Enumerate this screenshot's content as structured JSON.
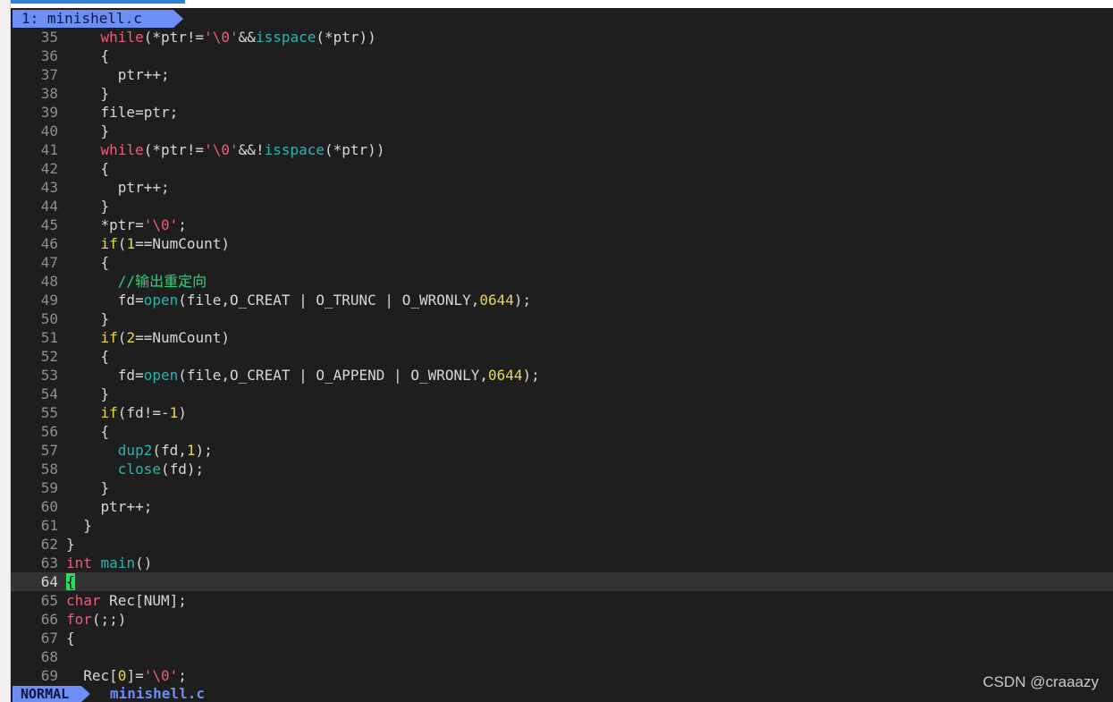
{
  "tabline": {
    "active_tab": "1: minishell.c"
  },
  "statusline": {
    "mode": "NORMAL",
    "filename": "minishell.c"
  },
  "watermark": "CSDN @craaazy",
  "colors": {
    "background": "#1e1e1e",
    "accent": "#6c8ef5",
    "keyword": "#ef5b7b",
    "function": "#28b4b0",
    "number": "#e9d94a",
    "comment": "#34d17a",
    "cursor": "#22e05a"
  },
  "editor": {
    "cursor_line": 64,
    "lines": [
      {
        "n": "35",
        "indent": "    ",
        "tokens": [
          {
            "t": "while",
            "c": "kw"
          },
          {
            "t": "(*ptr!="
          },
          {
            "t": "'\\0'",
            "c": "str"
          },
          {
            "t": "&&"
          },
          {
            "t": "isspace",
            "c": "fn"
          },
          {
            "t": "(*ptr))"
          }
        ]
      },
      {
        "n": "36",
        "indent": "    ",
        "tokens": [
          {
            "t": "{"
          }
        ]
      },
      {
        "n": "37",
        "indent": "      ",
        "tokens": [
          {
            "t": "ptr++;"
          }
        ]
      },
      {
        "n": "38",
        "indent": "    ",
        "tokens": [
          {
            "t": "}"
          }
        ]
      },
      {
        "n": "39",
        "indent": "    ",
        "tokens": [
          {
            "t": "file=ptr;"
          }
        ]
      },
      {
        "n": "40",
        "indent": "    ",
        "tokens": [
          {
            "t": "}"
          }
        ]
      },
      {
        "n": "41",
        "indent": "    ",
        "tokens": [
          {
            "t": "while",
            "c": "kw"
          },
          {
            "t": "(*ptr!="
          },
          {
            "t": "'\\0'",
            "c": "str"
          },
          {
            "t": "&&!"
          },
          {
            "t": "isspace",
            "c": "fn"
          },
          {
            "t": "(*ptr))"
          }
        ]
      },
      {
        "n": "42",
        "indent": "    ",
        "tokens": [
          {
            "t": "{"
          }
        ]
      },
      {
        "n": "43",
        "indent": "      ",
        "tokens": [
          {
            "t": "ptr++;"
          }
        ]
      },
      {
        "n": "44",
        "indent": "    ",
        "tokens": [
          {
            "t": "}"
          }
        ]
      },
      {
        "n": "45",
        "indent": "    ",
        "tokens": [
          {
            "t": "*ptr="
          },
          {
            "t": "'\\0'",
            "c": "str"
          },
          {
            "t": ";"
          }
        ]
      },
      {
        "n": "46",
        "indent": "    ",
        "tokens": [
          {
            "t": "if",
            "c": "num"
          },
          {
            "t": "("
          },
          {
            "t": "1",
            "c": "num"
          },
          {
            "t": "==NumCount)"
          }
        ]
      },
      {
        "n": "47",
        "indent": "    ",
        "tokens": [
          {
            "t": "{"
          }
        ]
      },
      {
        "n": "48",
        "indent": "      ",
        "tokens": [
          {
            "t": "//输出重定向",
            "c": "cm"
          }
        ]
      },
      {
        "n": "49",
        "indent": "      ",
        "tokens": [
          {
            "t": "fd="
          },
          {
            "t": "open",
            "c": "fn"
          },
          {
            "t": "(file,O_CREAT | O_TRUNC | O_WRONLY,"
          },
          {
            "t": "0644",
            "c": "num"
          },
          {
            "t": ");"
          }
        ]
      },
      {
        "n": "50",
        "indent": "    ",
        "tokens": [
          {
            "t": "}"
          }
        ]
      },
      {
        "n": "51",
        "indent": "    ",
        "tokens": [
          {
            "t": "if",
            "c": "num"
          },
          {
            "t": "("
          },
          {
            "t": "2",
            "c": "num"
          },
          {
            "t": "==NumCount)"
          }
        ]
      },
      {
        "n": "52",
        "indent": "    ",
        "tokens": [
          {
            "t": "{"
          }
        ]
      },
      {
        "n": "53",
        "indent": "      ",
        "tokens": [
          {
            "t": "fd="
          },
          {
            "t": "open",
            "c": "fn"
          },
          {
            "t": "(file,O_CREAT | O_APPEND | O_WRONLY,"
          },
          {
            "t": "0644",
            "c": "num"
          },
          {
            "t": ");"
          }
        ]
      },
      {
        "n": "54",
        "indent": "    ",
        "tokens": [
          {
            "t": "}"
          }
        ]
      },
      {
        "n": "55",
        "indent": "    ",
        "tokens": [
          {
            "t": "if",
            "c": "num"
          },
          {
            "t": "(fd!=-"
          },
          {
            "t": "1",
            "c": "num"
          },
          {
            "t": ")"
          }
        ]
      },
      {
        "n": "56",
        "indent": "    ",
        "tokens": [
          {
            "t": "{"
          }
        ]
      },
      {
        "n": "57",
        "indent": "      ",
        "tokens": [
          {
            "t": "dup2",
            "c": "fn"
          },
          {
            "t": "(fd,"
          },
          {
            "t": "1",
            "c": "num"
          },
          {
            "t": ");"
          }
        ]
      },
      {
        "n": "58",
        "indent": "      ",
        "tokens": [
          {
            "t": "close",
            "c": "fn"
          },
          {
            "t": "(fd);"
          }
        ]
      },
      {
        "n": "59",
        "indent": "    ",
        "tokens": [
          {
            "t": "}"
          }
        ]
      },
      {
        "n": "60",
        "indent": "    ",
        "tokens": [
          {
            "t": "ptr++;"
          }
        ]
      },
      {
        "n": "61",
        "indent": "  ",
        "tokens": [
          {
            "t": "}"
          }
        ]
      },
      {
        "n": "62",
        "indent": "",
        "tokens": [
          {
            "t": "}"
          }
        ]
      },
      {
        "n": "63",
        "indent": "",
        "tokens": [
          {
            "t": "int",
            "c": "kw"
          },
          {
            "t": " "
          },
          {
            "t": "main",
            "c": "fn"
          },
          {
            "t": "()"
          }
        ]
      },
      {
        "n": "64",
        "indent": "",
        "tokens": [
          {
            "t": "{",
            "c": "cur"
          }
        ]
      },
      {
        "n": "65",
        "indent": "",
        "tokens": [
          {
            "t": "char",
            "c": "kw"
          },
          {
            "t": " Rec[NUM];"
          }
        ]
      },
      {
        "n": "66",
        "indent": "",
        "tokens": [
          {
            "t": "for",
            "c": "kw"
          },
          {
            "t": "(;;)"
          }
        ]
      },
      {
        "n": "67",
        "indent": "",
        "tokens": [
          {
            "t": "{"
          }
        ]
      },
      {
        "n": "68",
        "indent": "",
        "tokens": []
      },
      {
        "n": "69",
        "indent": "  ",
        "tokens": [
          {
            "t": "Rec["
          },
          {
            "t": "0",
            "c": "num"
          },
          {
            "t": "]="
          },
          {
            "t": "'\\0'",
            "c": "str"
          },
          {
            "t": ";"
          }
        ]
      }
    ]
  }
}
